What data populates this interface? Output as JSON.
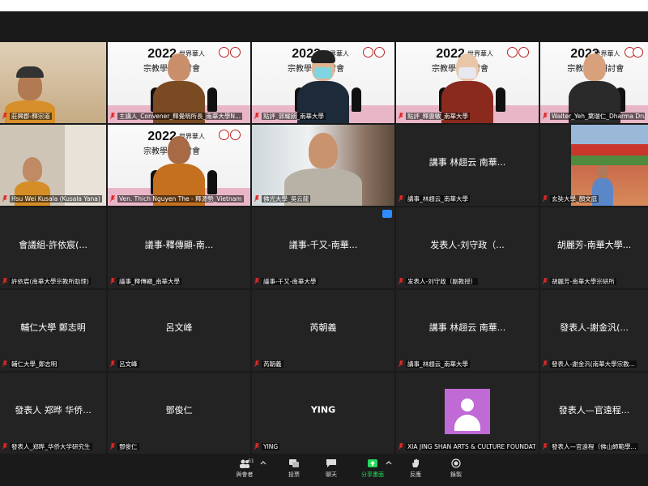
{
  "tiles": [
    {
      "name": "tile-r1c1",
      "label": "莊興郡-釋宗道",
      "kind": "video-plain"
    },
    {
      "name": "tile-r1c2",
      "label": "主講人_Convener_釋覺明所長_南華大學N...",
      "kind": "banner-speaker"
    },
    {
      "name": "tile-r1c3",
      "label": "點評_郭耀朗_南華大學",
      "kind": "banner-mask"
    },
    {
      "name": "tile-r1c4",
      "label": "點評_釋惠敏_南華大學",
      "kind": "banner-monk"
    },
    {
      "name": "tile-r1c5",
      "label": "Walter_Yeh_葉瑞仁_Dharma Drum...",
      "kind": "banner-man"
    },
    {
      "name": "tile-r2c1",
      "label": "Hsu Wei Kusala (Kusala Yana)",
      "kind": "video-plain"
    },
    {
      "name": "tile-r2c2",
      "label": "Ven. Thich Nguyen The - 釋源勢_Vietnam",
      "kind": "banner-monk2"
    },
    {
      "name": "tile-r2c3",
      "label": "佛光大學_吳云龍",
      "kind": "video-room"
    },
    {
      "name": "tile-r2c4",
      "label": "講事_林趐云_南華大學",
      "center": "講事 林趐云 南華...",
      "kind": "name"
    },
    {
      "name": "tile-r2c5",
      "label": "玄奘大學_顏文庭",
      "kind": "video-temple"
    },
    {
      "name": "tile-r3c1",
      "label": "許依宸(南華大學宗教所助理)",
      "center": "會議組-許依宸(...",
      "kind": "name"
    },
    {
      "name": "tile-r3c2",
      "label": "議事_釋傳顯_南華大學",
      "center": "議事-釋傳顯-南...",
      "kind": "name"
    },
    {
      "name": "tile-r3c3",
      "label": "議事-千又-南華大學",
      "center": "議事-千又-南華...",
      "kind": "name",
      "badge": true
    },
    {
      "name": "tile-r3c4",
      "label": "发表人-刘守政（副教授）",
      "center": "发表人-刘守政（...",
      "kind": "name"
    },
    {
      "name": "tile-r3c5",
      "label": "胡麗芳-南華大學宗研所",
      "center": "胡麗芳-南華大學...",
      "kind": "name"
    },
    {
      "name": "tile-r4c1",
      "label": "輔仁大學_鄭志明",
      "center": "輔仁大學 鄭志明",
      "kind": "name"
    },
    {
      "name": "tile-r4c2",
      "label": "呂文峰",
      "center": "呂文峰",
      "kind": "name"
    },
    {
      "name": "tile-r4c3",
      "label": "芮朝義",
      "center": "芮朝義",
      "kind": "name"
    },
    {
      "name": "tile-r4c4",
      "label": "講事_林趐云_南華大學",
      "center": "講事 林趐云 南華...",
      "kind": "name"
    },
    {
      "name": "tile-r4c5",
      "label": "發表人-謝金汎(南華大學宗教...",
      "center": "發表人-謝金汎(...",
      "kind": "name"
    },
    {
      "name": "tile-r5c1",
      "label": "發表人_郑晔_华侨大学研究生",
      "center": "發表人 郑晔 华侨...",
      "kind": "name"
    },
    {
      "name": "tile-r5c2",
      "label": "鄧俊仁",
      "center": "鄧俊仁",
      "kind": "name"
    },
    {
      "name": "tile-r5c3",
      "label": "YING",
      "center": "YING",
      "kind": "name-latin"
    },
    {
      "name": "tile-r5c4",
      "label": "XIA JING SHAN ARTS & CULTURE FOUNDATION",
      "kind": "avatar"
    },
    {
      "name": "tile-r5c5",
      "label": "發表人—官遠程（佛山師範學...",
      "center": "發表人—官遠程...",
      "kind": "name"
    }
  ],
  "banner": {
    "title_year": "2022",
    "title_top": "世界華人",
    "title_sub": "宗教學術研討會"
  },
  "toolbar": {
    "participants": {
      "label": "與會者",
      "count": "61"
    },
    "chat": {
      "label": "聊天"
    },
    "share": {
      "label": "分享畫面"
    },
    "reactions": {
      "label": "反應"
    },
    "record": {
      "label": "錄製"
    },
    "polls": {
      "label": "投票"
    }
  },
  "colors": {
    "share_green": "#23d959",
    "muted_red": "#e02828",
    "active_border": "#e8e84a",
    "avatar_purple": "#c06ad6"
  }
}
